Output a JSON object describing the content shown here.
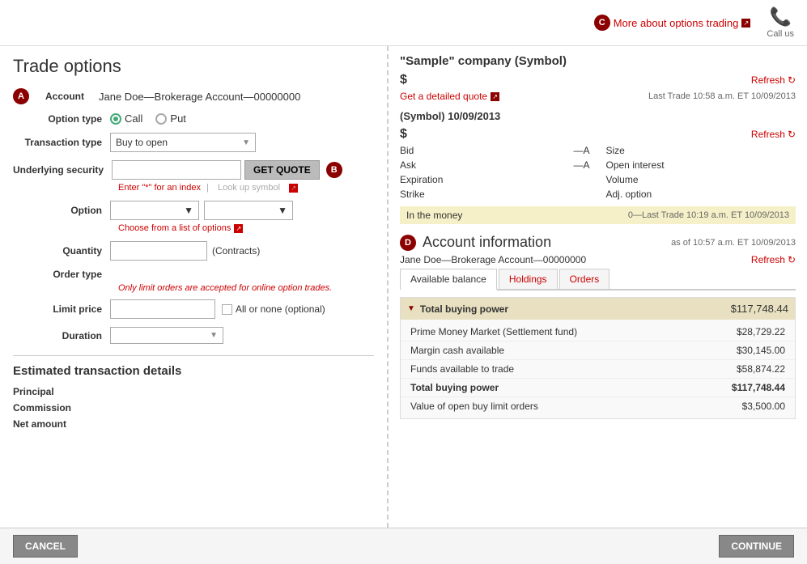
{
  "page": {
    "title": "Trade options"
  },
  "topbar": {
    "more_about_label": "More about options trading",
    "call_us_label": "Call us"
  },
  "form": {
    "account_badge": "A",
    "account_label": "Account",
    "account_value": "Jane Doe—Brokerage Account—00000000",
    "option_type_label": "Option type",
    "call_label": "Call",
    "put_label": "Put",
    "transaction_type_label": "Transaction type",
    "transaction_type_value": "Buy to open",
    "underlying_label": "Underlying security",
    "get_quote_btn": "GET QUOTE",
    "badge_b": "B",
    "enter_hint": "Enter \"*\" for an index",
    "look_up_label": "Look up symbol",
    "option_label": "Option",
    "choose_options_label": "Choose from a list of options",
    "quantity_label": "Quantity",
    "contracts_label": "(Contracts)",
    "order_type_label": "Order type",
    "order_type_note": "Only limit orders are accepted for online option trades.",
    "limit_price_label": "Limit price",
    "all_or_none_label": "All or none (optional)",
    "duration_label": "Duration"
  },
  "estimated": {
    "title": "Estimated transaction details",
    "principal_label": "Principal",
    "commission_label": "Commission",
    "net_amount_label": "Net amount"
  },
  "buttons": {
    "cancel": "CANCEL",
    "continue": "CONTInUe"
  },
  "right": {
    "company_title": "\"Sample\" company (Symbol)",
    "dollar_sign": "$",
    "refresh_label": "Refresh",
    "get_detail_quote": "Get a detailed quote",
    "last_trade": "Last Trade 10:58 a.m. ET 10/09/2013",
    "symbol_date": "(Symbol) 10/09/2013",
    "bid_label": "Bid",
    "bid_value": "—A",
    "ask_label": "Ask",
    "ask_value": "—A",
    "expiration_label": "Expiration",
    "expiration_value": "",
    "strike_label": "Strike",
    "strike_value": "",
    "size_label": "Size",
    "size_value": "",
    "open_interest_label": "Open interest",
    "open_interest_value": "",
    "volume_label": "Volume",
    "volume_value": "",
    "adj_option_label": "Adj. option",
    "adj_option_value": "",
    "in_the_money": "In the money",
    "last_trade2": "0—Last Trade 10:19 a.m. ET 10/09/2013"
  },
  "account_info": {
    "badge_d": "D",
    "title": "Account information",
    "as_of": "as of 10:57 a.m. ET 10/09/2013",
    "account_name": "Jane Doe—Brokerage Account—00000000",
    "refresh_label": "Refresh",
    "tabs": [
      {
        "label": "Available balance",
        "active": true
      },
      {
        "label": "Holdings",
        "active": false
      },
      {
        "label": "Orders",
        "active": false
      }
    ],
    "total_buying_power_label": "Total buying power",
    "total_buying_power_value": "$117,748.44",
    "rows": [
      {
        "label": "Prime Money Market (Settlement fund)",
        "value": "$28,729.22",
        "bold": false
      },
      {
        "label": "Margin cash available",
        "value": "$30,145.00",
        "bold": false
      },
      {
        "label": "Funds available to trade",
        "value": "$58,874.22",
        "bold": false
      },
      {
        "label": "Total buying power",
        "value": "$117,748.44",
        "bold": true
      },
      {
        "label": "Value of open buy limit orders",
        "value": "$3,500.00",
        "bold": false
      }
    ]
  }
}
